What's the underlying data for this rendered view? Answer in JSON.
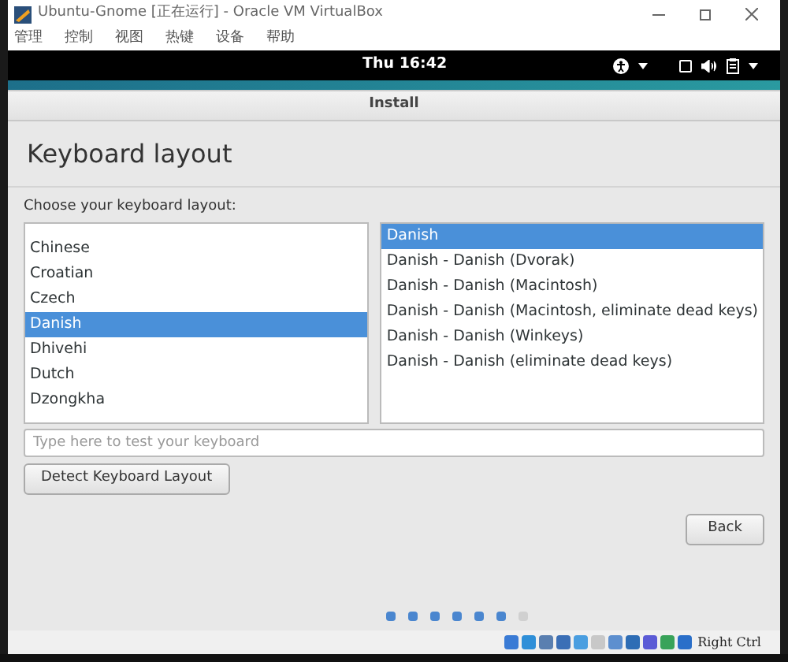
{
  "window": {
    "title": "Ubuntu-Gnome [正在运行] - Oracle VM VirtualBox"
  },
  "menu": [
    "管理",
    "控制",
    "视图",
    "热键",
    "设备",
    "帮助"
  ],
  "top_bar": {
    "clock": "Thu 16:42"
  },
  "dialog": {
    "title": "Install",
    "heading": "Keyboard layout",
    "prompt": "Choose your keyboard layout:",
    "layouts": [
      {
        "label": "Chinese",
        "selected": false
      },
      {
        "label": "Croatian",
        "selected": false
      },
      {
        "label": "Czech",
        "selected": false
      },
      {
        "label": "Danish",
        "selected": true
      },
      {
        "label": "Dhivehi",
        "selected": false
      },
      {
        "label": "Dutch",
        "selected": false
      },
      {
        "label": "Dzongkha",
        "selected": false
      }
    ],
    "variants": [
      {
        "label": "Danish",
        "selected": true
      },
      {
        "label": "Danish - Danish (Dvorak)",
        "selected": false
      },
      {
        "label": "Danish - Danish (Macintosh)",
        "selected": false
      },
      {
        "label": "Danish - Danish (Macintosh, eliminate dead keys)",
        "selected": false
      },
      {
        "label": "Danish - Danish (Winkeys)",
        "selected": false
      },
      {
        "label": "Danish - Danish (eliminate dead keys)",
        "selected": false
      }
    ],
    "test_field": {
      "placeholder": "Type here to test your keyboard"
    },
    "detect_button": "Detect Keyboard Layout",
    "back_button": "Back",
    "steps": [
      {
        "done": true
      },
      {
        "done": true
      },
      {
        "done": true
      },
      {
        "done": true
      },
      {
        "done": true
      },
      {
        "done": true
      },
      {
        "done": false
      }
    ]
  },
  "status_bar": {
    "host_key": "Right Ctrl"
  }
}
